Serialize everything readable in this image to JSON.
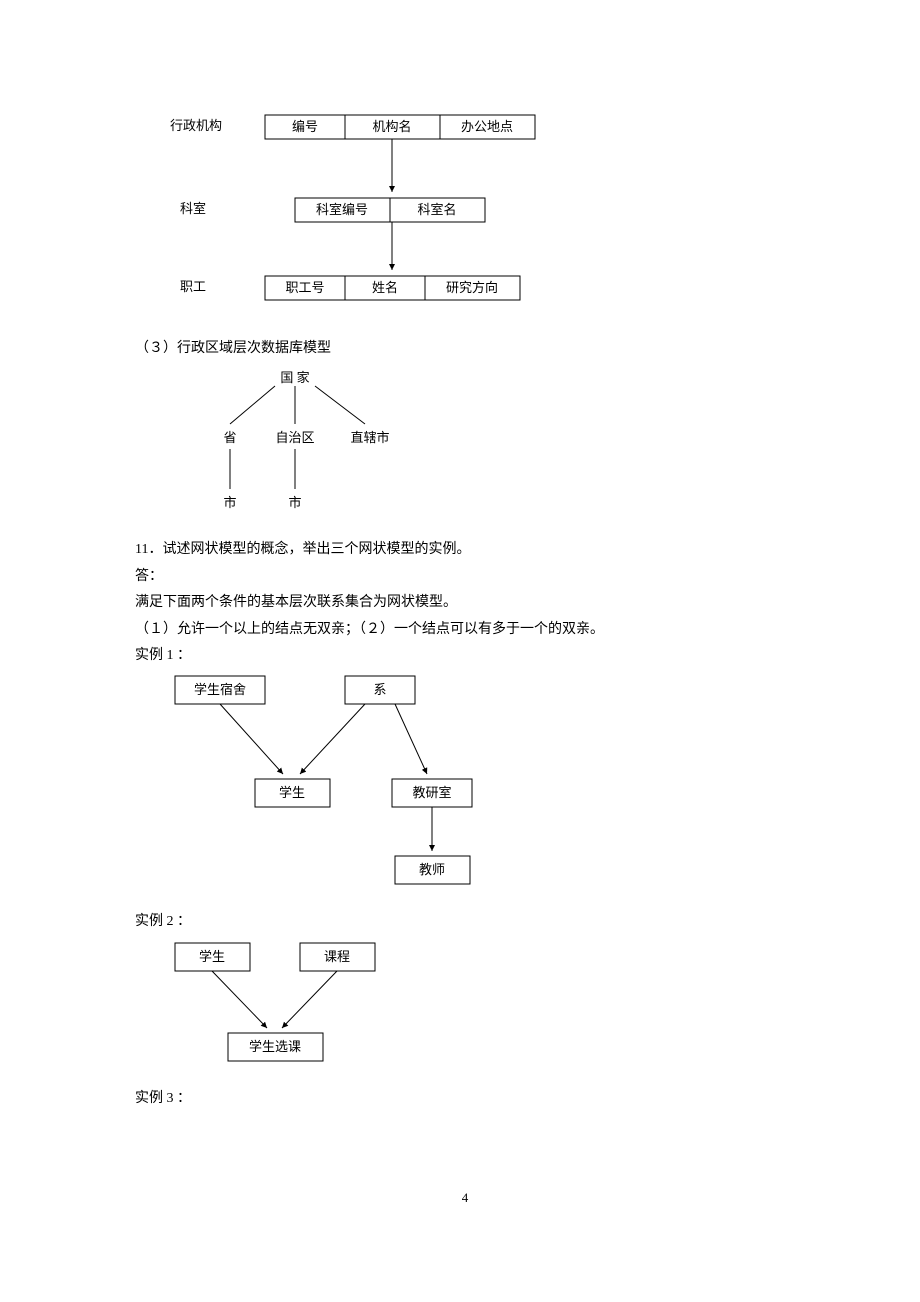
{
  "diagram1": {
    "row1_label": "行政机构",
    "row1_cells": [
      "编号",
      "机构名",
      "办公地点"
    ],
    "row2_label": "科室",
    "row2_cells": [
      "科室编号",
      "科室名"
    ],
    "row3_label": "职工",
    "row3_cells": [
      "职工号",
      "姓名",
      "研究方向"
    ]
  },
  "para1": "（３）行政区域层次数据库模型",
  "diagram2": {
    "top": "国  家",
    "mid": [
      "省",
      "自治区",
      "直辖市"
    ],
    "bot": [
      "市",
      "市"
    ]
  },
  "para2": "11．试述网状模型的概念，举出三个网状模型的实例。",
  "para3": "答：",
  "para4": "满足下面两个条件的基本层次联系集合为网状模型。",
  "para5": "（１）允许一个以上的结点无双亲；（２）一个结点可以有多于一个的双亲。",
  "para6": "实例 1 ：",
  "diagram3": {
    "top_left": "学生宿舍",
    "top_right": "系",
    "mid_left": "学生",
    "mid_right": "教研室",
    "bot": "教师"
  },
  "para7": "实例 2 ：",
  "diagram4": {
    "top_left": "学生",
    "top_right": "课程",
    "bot": "学生选课"
  },
  "para8": "实例 3 ：",
  "page_number": "4"
}
